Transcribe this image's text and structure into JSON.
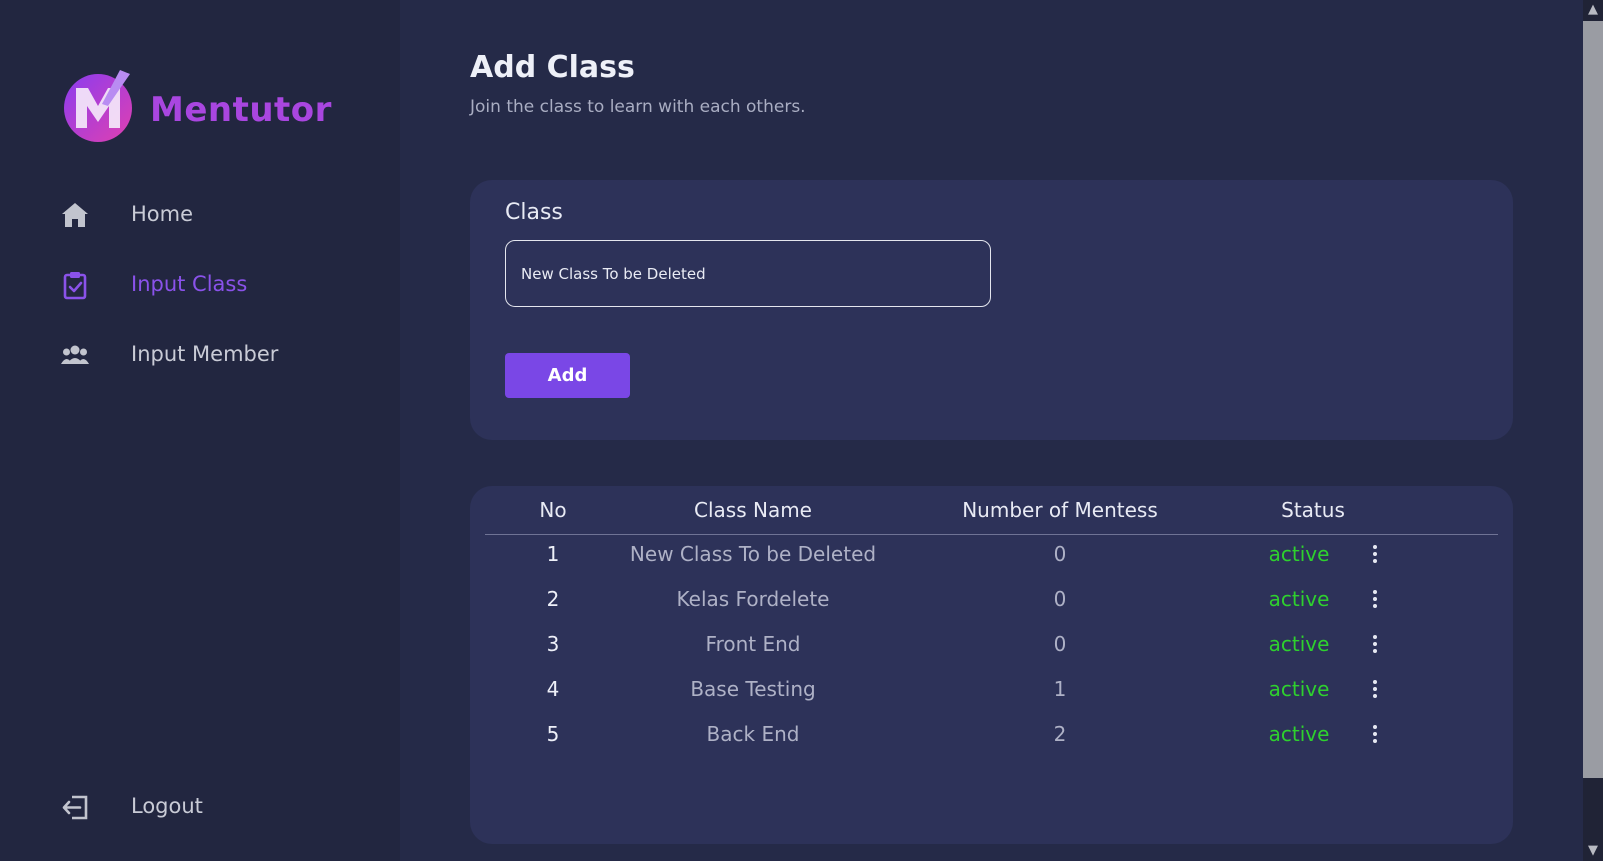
{
  "brand": {
    "name": "Mentutor",
    "accent": "#a946e0"
  },
  "sidebar": {
    "items": [
      {
        "label": "Home",
        "icon": "home-icon",
        "active": false
      },
      {
        "label": "Input Class",
        "icon": "clipboard-check-icon",
        "active": true
      },
      {
        "label": "Input Member",
        "icon": "users-icon",
        "active": false
      }
    ],
    "logout": {
      "label": "Logout",
      "icon": "logout-icon"
    }
  },
  "page": {
    "title": "Add Class",
    "subtitle": "Join the class to learn with each others."
  },
  "form": {
    "label": "Class",
    "input_value": "New Class To be Deleted",
    "add_label": "Add",
    "button_color": "#7a47e6"
  },
  "table": {
    "columns": [
      "No",
      "Class Name",
      "Number of Mentess",
      "Status"
    ],
    "rows": [
      {
        "no": "1",
        "name": "New Class To be Deleted",
        "count": "0",
        "status": "active"
      },
      {
        "no": "2",
        "name": "Kelas Fordelete",
        "count": "0",
        "status": "active"
      },
      {
        "no": "3",
        "name": "Front End",
        "count": "0",
        "status": "active"
      },
      {
        "no": "4",
        "name": "Base Testing",
        "count": "1",
        "status": "active"
      },
      {
        "no": "5",
        "name": "Back End",
        "count": "2",
        "status": "active"
      }
    ],
    "status_color": "#2ed12e",
    "row_menu_icon": "kebab-menu-icon"
  }
}
